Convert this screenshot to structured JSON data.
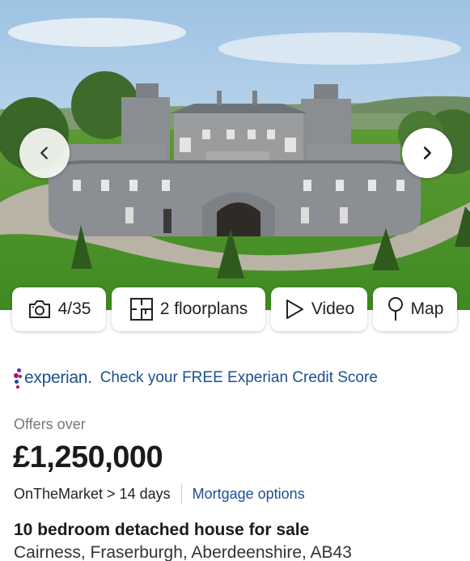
{
  "gallery": {
    "current": 4,
    "total": 35,
    "prev_icon": "chevron-left-icon",
    "next_icon": "chevron-right-icon"
  },
  "media_buttons": {
    "photos_label": "4/35",
    "photos_icon": "camera-icon",
    "floorplans_label": "2 floorplans",
    "floorplans_icon": "floorplan-icon",
    "video_label": "Video",
    "video_icon": "play-icon",
    "map_label": "Map",
    "map_icon": "map-pin-icon"
  },
  "experian": {
    "logo_text": "experian.",
    "cta": "Check your FREE Experian Credit Score",
    "colors": {
      "text": "#1d4f91",
      "dot_purple": "#6f2c91",
      "dot_magenta": "#c1006f",
      "dot_blue": "#1d4f91"
    }
  },
  "listing": {
    "price_qualifier": "Offers over",
    "price": "£1,250,000",
    "agent_line": "OnTheMarket > 14 days",
    "mortgage_link": "Mortgage options",
    "title": "10 bedroom detached house for sale",
    "address": "Cairness, Fraserburgh, Aberdeenshire, AB43"
  },
  "colors": {
    "link": "#1d4f91",
    "text": "#1b1b1b",
    "muted": "#777777"
  }
}
